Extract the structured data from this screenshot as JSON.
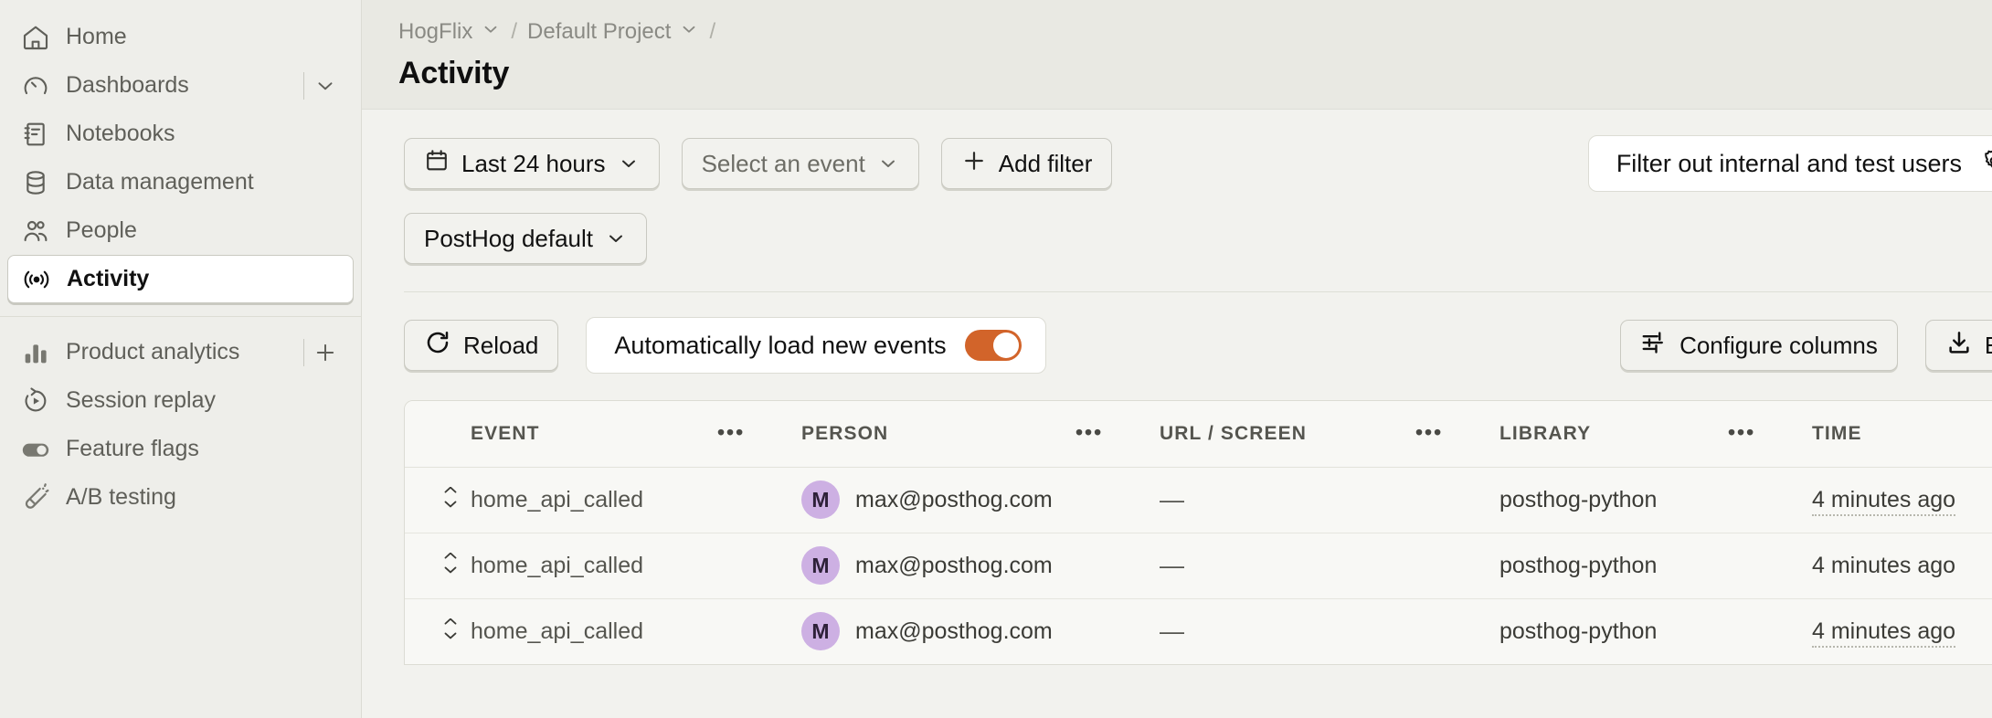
{
  "sidebar": {
    "items": [
      {
        "label": "Home",
        "icon": "home-icon",
        "active": false,
        "tail": "none"
      },
      {
        "label": "Dashboards",
        "icon": "dashboard-gauge-icon",
        "active": false,
        "tail": "chevron"
      },
      {
        "label": "Notebooks",
        "icon": "notebook-icon",
        "active": false,
        "tail": "none"
      },
      {
        "label": "Data management",
        "icon": "database-icon",
        "active": false,
        "tail": "none"
      },
      {
        "label": "People",
        "icon": "people-icon",
        "active": false,
        "tail": "none"
      },
      {
        "label": "Activity",
        "icon": "activity-broadcast-icon",
        "active": true,
        "tail": "none"
      }
    ],
    "items2": [
      {
        "label": "Product analytics",
        "icon": "bar-chart-icon",
        "active": false,
        "tail": "plus"
      },
      {
        "label": "Session replay",
        "icon": "replay-icon",
        "active": false,
        "tail": "none"
      },
      {
        "label": "Feature flags",
        "icon": "feature-flag-toggle-icon",
        "active": false,
        "tail": "none"
      },
      {
        "label": "A/B testing",
        "icon": "flask-icon",
        "active": false,
        "tail": "none"
      }
    ]
  },
  "header": {
    "breadcrumb": {
      "org": "HogFlix",
      "separator": "/",
      "project": "Default Project",
      "trailing_separator": "/"
    },
    "title": "Activity"
  },
  "filters": {
    "date_range": "Last 24 hours",
    "event_select": "Select an event",
    "add_filter": "Add filter",
    "internal_users_label": "Filter out internal and test users",
    "internal_users_toggle_on": false,
    "test_account_preset": "PostHog default"
  },
  "toolbar": {
    "reload": "Reload",
    "auto_load_label": "Automatically load new events",
    "auto_load_toggle_on": true,
    "configure_columns": "Configure columns",
    "export": "Export"
  },
  "table": {
    "columns": [
      "EVENT",
      "PERSON",
      "URL / SCREEN",
      "LIBRARY",
      "TIME"
    ],
    "menu_glyph": "•••",
    "rows": [
      {
        "event": "home_api_called",
        "person": "max@posthog.com",
        "person_initial": "M",
        "url": "—",
        "library": "posthog-python",
        "time": "4 minutes ago"
      },
      {
        "event": "home_api_called",
        "person": "max@posthog.com",
        "person_initial": "M",
        "url": "—",
        "library": "posthog-python",
        "time": "4 minutes ago"
      },
      {
        "event": "home_api_called",
        "person": "max@posthog.com",
        "person_initial": "M",
        "url": "—",
        "library": "posthog-python",
        "time": "4 minutes ago"
      }
    ]
  },
  "colors": {
    "accent_orange": "#d2642a",
    "avatar_purple": "#cdb0e3",
    "sidebar_bg": "#eeeeea",
    "header_bg": "#e9e9e3",
    "page_bg": "#f2f2ee"
  }
}
